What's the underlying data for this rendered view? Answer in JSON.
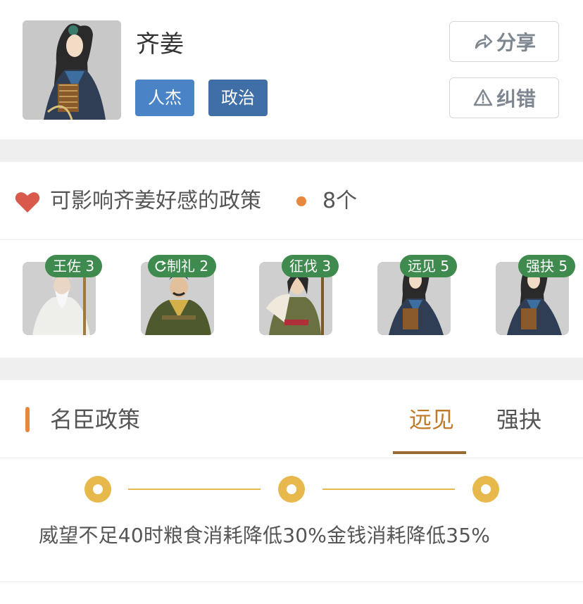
{
  "profile": {
    "name": "齐姜",
    "tags": [
      "人杰",
      "政治"
    ],
    "share_label": "分享",
    "report_label": "纠错"
  },
  "favor": {
    "title": "可影响齐姜好感的政策",
    "count": "8个"
  },
  "policies": [
    {
      "label": "王佐 3",
      "icon": "none"
    },
    {
      "label": "制礼 2",
      "icon": "refresh-icon"
    },
    {
      "label": "征伐 3",
      "icon": "none"
    },
    {
      "label": "远见 5",
      "icon": "none"
    },
    {
      "label": "强抉 5",
      "icon": "none"
    }
  ],
  "ministers": {
    "title": "名臣政策",
    "tabs": [
      "远见",
      "强抉"
    ],
    "active_tab": "远见",
    "description": "威望不足40时粮食消耗降低30%金钱消耗降低35%"
  },
  "colors": {
    "tag_renjie": "#4a84c6",
    "tag_zhengzhi": "#3f6fa6",
    "badge_green": "#3f8a4e",
    "accent_orange": "#e8873e",
    "tab_active": "#c07a2a",
    "timeline_gold": "#e7b84b"
  }
}
